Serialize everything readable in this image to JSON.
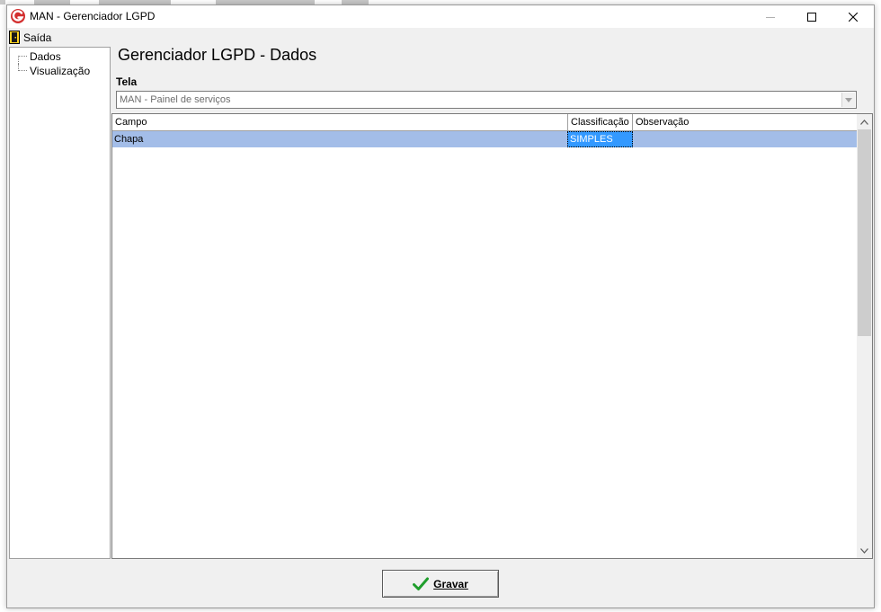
{
  "window": {
    "title": "MAN - Gerenciador LGPD"
  },
  "menu": {
    "exit_label": "Saída"
  },
  "tree": {
    "items": [
      {
        "label": "Dados"
      },
      {
        "label": "Visualização"
      }
    ]
  },
  "main": {
    "heading": "Gerenciador LGPD - Dados",
    "tela_label": "Tela",
    "tela_value": "MAN - Painel de serviços"
  },
  "grid": {
    "columns": [
      "Campo",
      "Classificação",
      "Observação"
    ],
    "rows": [
      {
        "campo": "Chapa",
        "classificacao": "SIMPLES",
        "observacao": ""
      }
    ]
  },
  "footer": {
    "save_label": "Gravar"
  },
  "colors": {
    "selected_row": "#a3bde8",
    "active_cell": "#3399ff",
    "logo_red": "#d32f2f",
    "check_green": "#1f9e2c"
  },
  "icons": [
    "app-logo-icon",
    "minimize-icon",
    "maximize-icon",
    "close-icon",
    "exit-door-icon",
    "dropdown-arrow-icon",
    "scroll-up-icon",
    "scroll-down-icon",
    "checkmark-icon"
  ]
}
